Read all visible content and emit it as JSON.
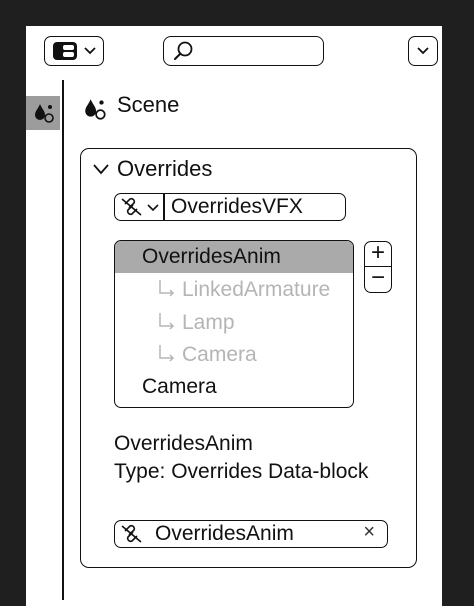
{
  "header": {
    "editor_type_icon": "editor-type-icon",
    "search_icon": "search-icon",
    "options_icon": "chevron-down-icon"
  },
  "sidebar": {
    "active_tab_icon": "scene-properties-icon"
  },
  "scene": {
    "label": "Scene"
  },
  "overrides_panel": {
    "title": "Overrides",
    "source_dropdown_value": "OverridesVFX",
    "list_items": [
      {
        "label": "OverridesAnim",
        "selected": true,
        "child": false
      },
      {
        "label": "LinkedArmature",
        "selected": false,
        "child": true
      },
      {
        "label": "Lamp",
        "selected": false,
        "child": true
      },
      {
        "label": "Camera",
        "selected": false,
        "child": true
      },
      {
        "label": "Camera",
        "selected": false,
        "child": false
      }
    ],
    "add_label": "+",
    "remove_label": "−",
    "info_name": "OverridesAnim",
    "info_type": "Type: Overrides Data-block",
    "field_value": "OverridesAnim",
    "clear_label": "×"
  }
}
